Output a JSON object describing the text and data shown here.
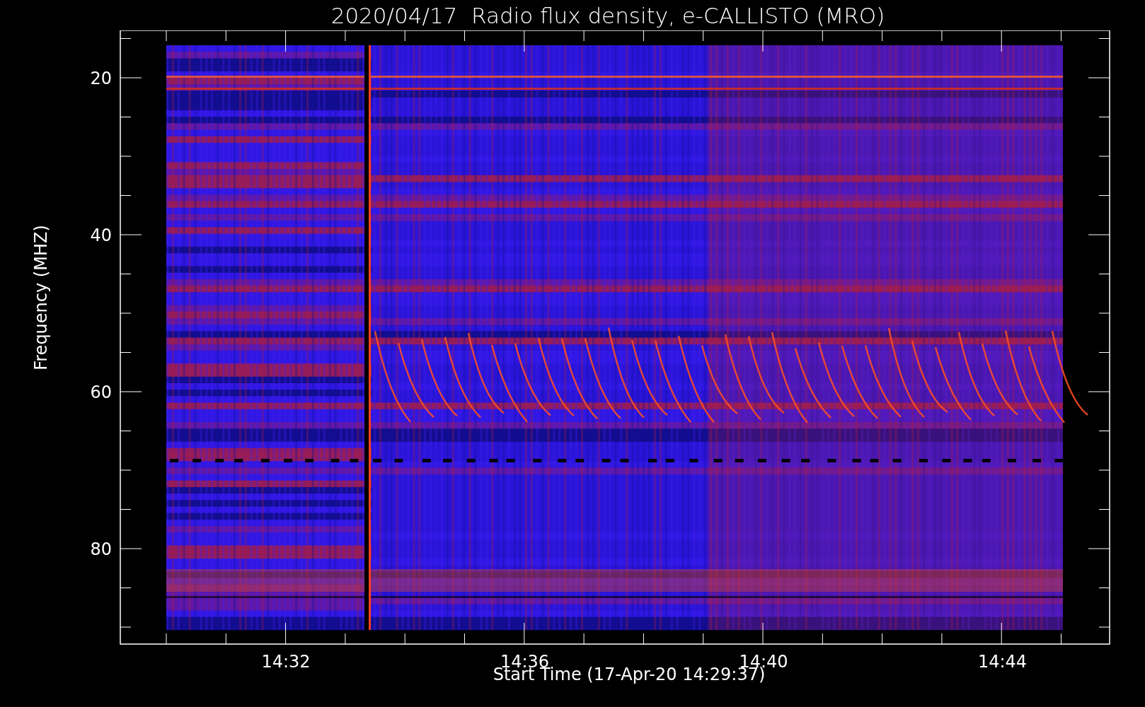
{
  "title": "2020/04/17  Radio flux density, e-CALLISTO (MRO)",
  "y_axis": {
    "label": "Frequency (MHZ)",
    "ticks": [
      "20",
      "40",
      "60",
      "80"
    ]
  },
  "x_axis": {
    "label": "Start Time (17-Apr-20 14:29:37)",
    "ticks": [
      "14:32",
      "14:36",
      "14:40",
      "14:44"
    ]
  }
}
